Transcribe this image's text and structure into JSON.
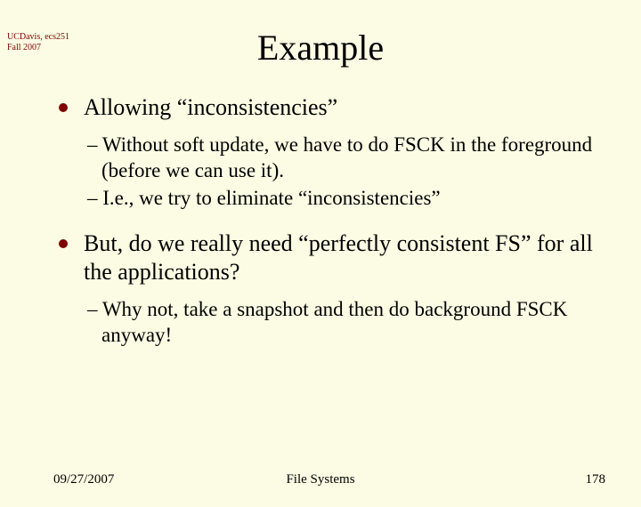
{
  "header": {
    "line1": "UCDavis, ecs251",
    "line2": "Fall 2007"
  },
  "title": "Example",
  "body": {
    "p1": "Allowing “inconsistencies”",
    "p1a": "– Without soft update, we have to do FSCK in the foreground (before we can use it).",
    "p1b": "– I.e., we try to eliminate “inconsistencies”",
    "p2": "But, do we really need “perfectly consistent FS” for all the applications?",
    "p2a": "– Why not, take a snapshot and then do background FSCK anyway!"
  },
  "footer": {
    "date": "09/27/2007",
    "topic": "File Systems",
    "page": "178"
  }
}
